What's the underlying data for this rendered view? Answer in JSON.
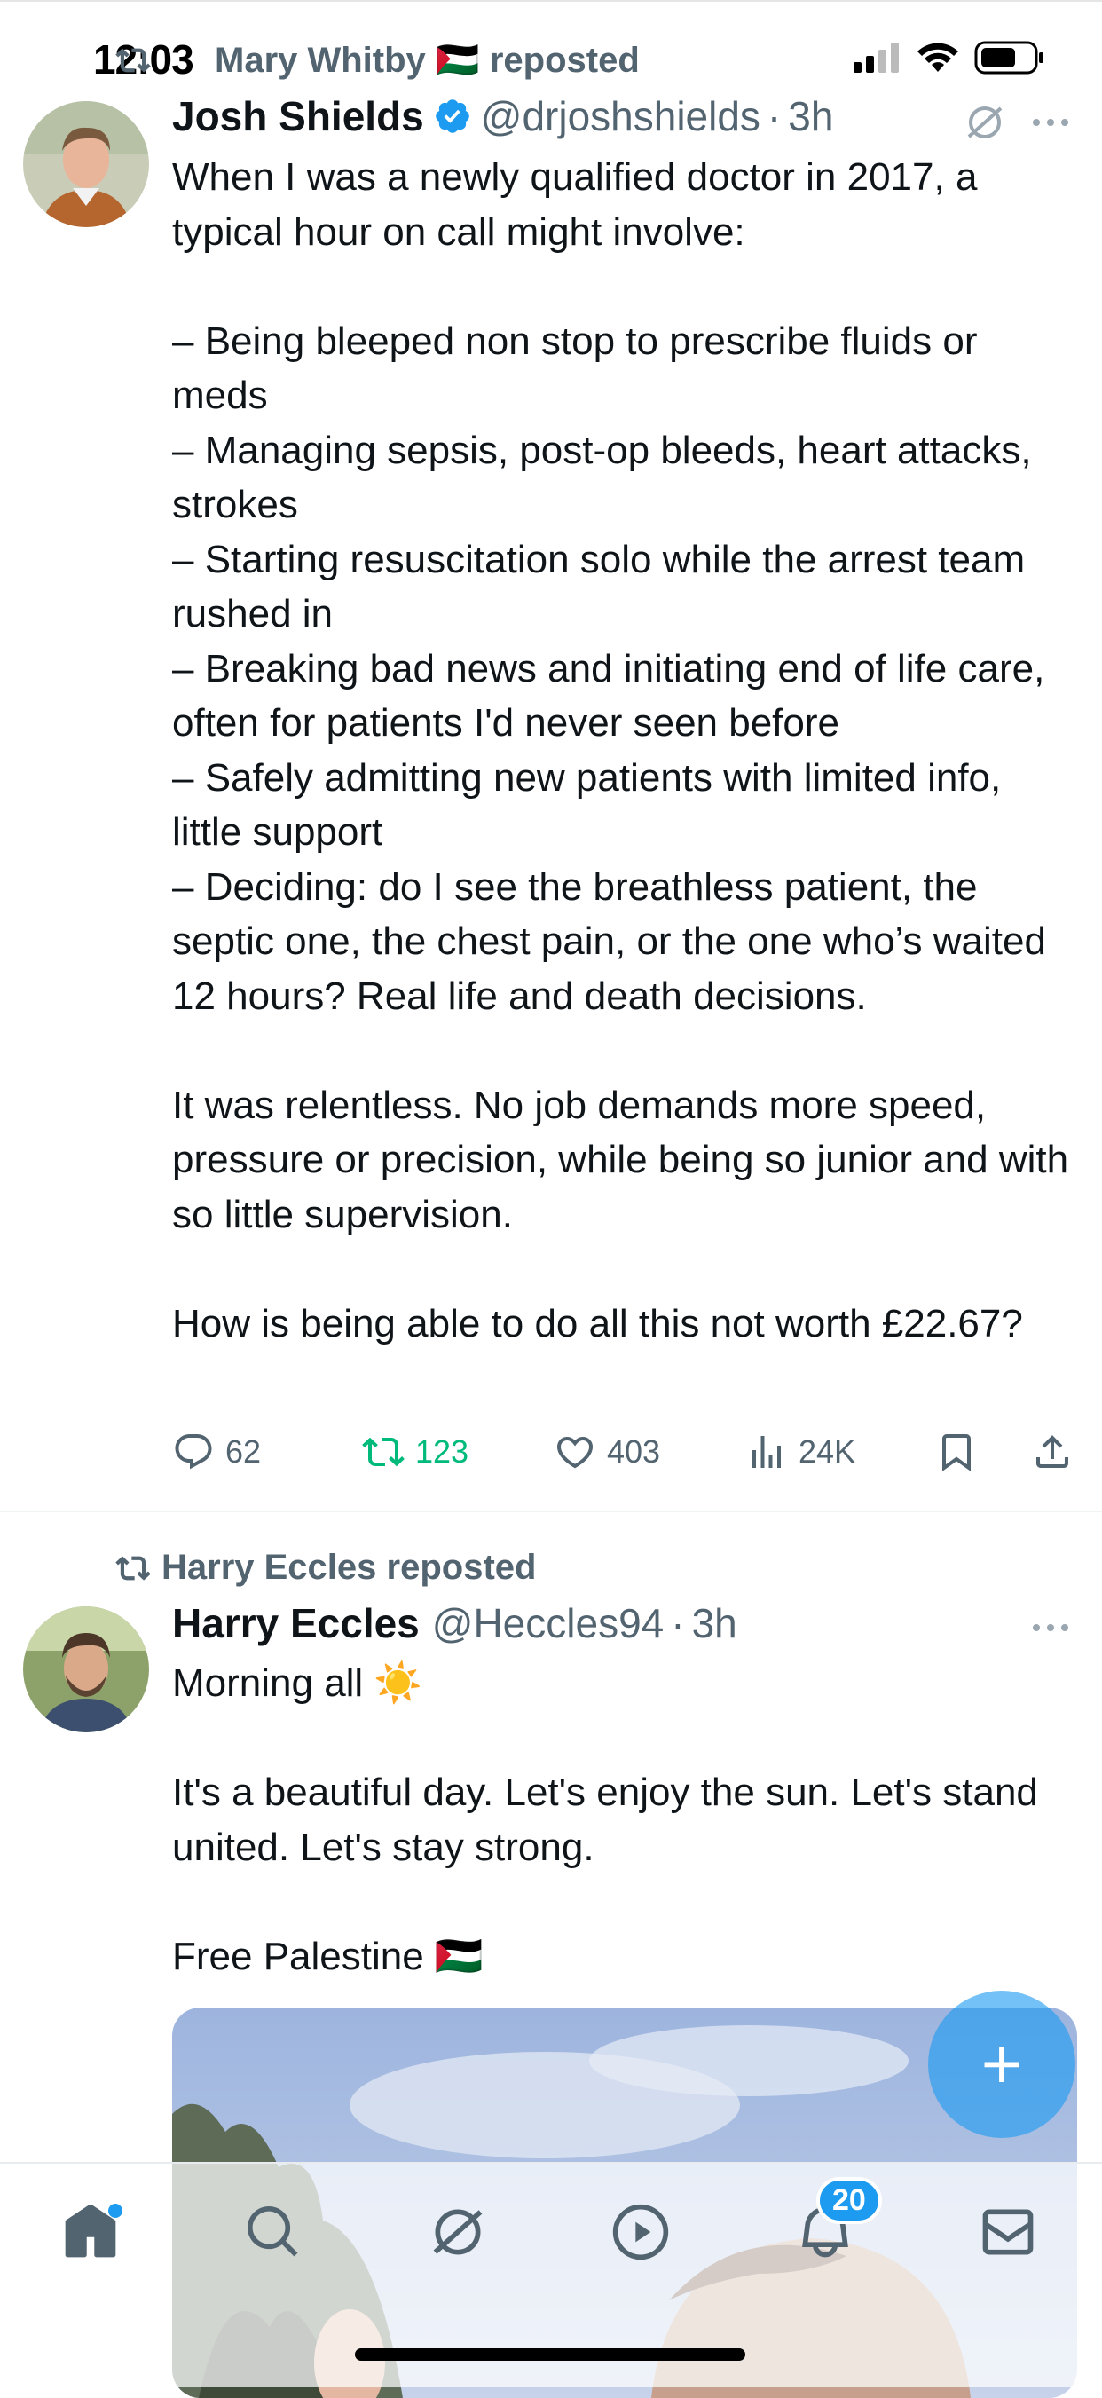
{
  "status_bar": {
    "time": "12:03",
    "battery_icon": "battery-icon",
    "wifi_icon": "wifi-icon",
    "signal_icon": "signal-icon"
  },
  "tweets": [
    {
      "repost_label": "Mary Whitby 🇵🇸 reposted",
      "author_name": "Josh Shields",
      "verified": true,
      "handle": "@drjoshshields",
      "separator": "·",
      "time": "3h",
      "text": "When I was a newly qualified doctor in 2017, a typical hour on call might involve:\n\n– Being bleeped non stop to prescribe fluids or meds\n– Managing sepsis, post-op bleeds, heart attacks, strokes\n– Starting resuscitation solo while the arrest team rushed in\n– Breaking bad news and initiating end of life care, often for patients I'd never seen before\n– Safely admitting new patients with limited info, little support\n– Deciding: do I see the breathless patient, the septic one, the chest pain, or the one who’s waited 12 hours? Real life and death decisions.\n\nIt was relentless. No job demands more speed, pressure or precision, while being so junior and with so little supervision.\n\nHow is being able to do all this not worth £22.67?",
      "counts": {
        "replies": "62",
        "reposts": "123",
        "likes": "403",
        "views": "24K"
      }
    },
    {
      "repost_label": "Harry Eccles reposted",
      "author_name": "Harry Eccles",
      "handle": "@Heccles94",
      "separator": "·",
      "time": "3h",
      "text": "Morning all ☀️\n\nIt's a beautiful day. Let's enjoy the sun. Let's stand united. Let's stay strong.\n\nFree Palestine 🇵🇸"
    }
  ],
  "fab": {
    "label": "+"
  },
  "tab_bar": {
    "items": [
      "home",
      "search",
      "grok",
      "video",
      "notifications",
      "messages"
    ],
    "notifications_badge": "20"
  },
  "colors": {
    "accent": "#1d9bf0",
    "repost_green": "#00ba7c",
    "secondary_text": "#536471"
  }
}
